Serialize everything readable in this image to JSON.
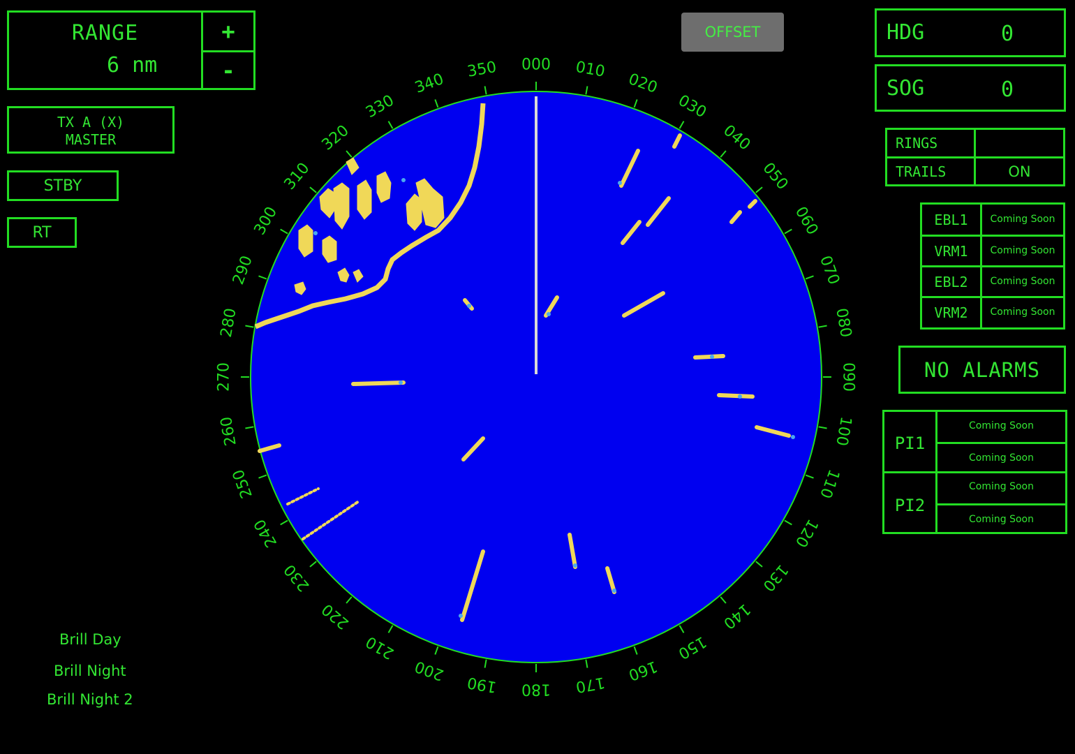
{
  "range": {
    "label": "RANGE",
    "value": "6 nm",
    "increase": "+",
    "decrease": "-"
  },
  "tx": {
    "line1": "TX A (X)",
    "line2": "MASTER"
  },
  "stby": "STBY",
  "rt": "RT",
  "offset": "OFFSET",
  "hdg": {
    "label": "HDG",
    "value": "0"
  },
  "sog": {
    "label": "SOG",
    "value": "0"
  },
  "rings": {
    "label": "RINGS",
    "value": ""
  },
  "trails": {
    "label": "TRAILS",
    "value": "ON"
  },
  "ebl_vrm": [
    {
      "label": "EBL1",
      "value": "Coming Soon"
    },
    {
      "label": "VRM1",
      "value": "Coming Soon"
    },
    {
      "label": "EBL2",
      "value": "Coming Soon"
    },
    {
      "label": "VRM2",
      "value": "Coming Soon"
    }
  ],
  "alarm": "NO ALARMS",
  "pi": [
    {
      "label": "PI1",
      "values": [
        "Coming Soon",
        "Coming Soon"
      ]
    },
    {
      "label": "PI2",
      "values": [
        "Coming Soon",
        "Coming Soon"
      ]
    }
  ],
  "brilliance": [
    "Brill Day",
    "Brill Night",
    "Brill Night 2"
  ],
  "radar": {
    "bearing_labels": [
      "000",
      "010",
      "020",
      "030",
      "040",
      "050",
      "060",
      "070",
      "080",
      "090",
      "100",
      "110",
      "120",
      "130",
      "140",
      "150",
      "160",
      "170",
      "180",
      "190",
      "200",
      "210",
      "220",
      "230",
      "240",
      "250",
      "260",
      "270",
      "280",
      "290",
      "300",
      "310",
      "320",
      "330",
      "340",
      "350"
    ],
    "colors": {
      "background": "#0000f0",
      "land": "#f0d858",
      "echo_edge": "#4aa8f0",
      "scale": "#22dd22",
      "heading_line": "#d8d8d8"
    }
  }
}
